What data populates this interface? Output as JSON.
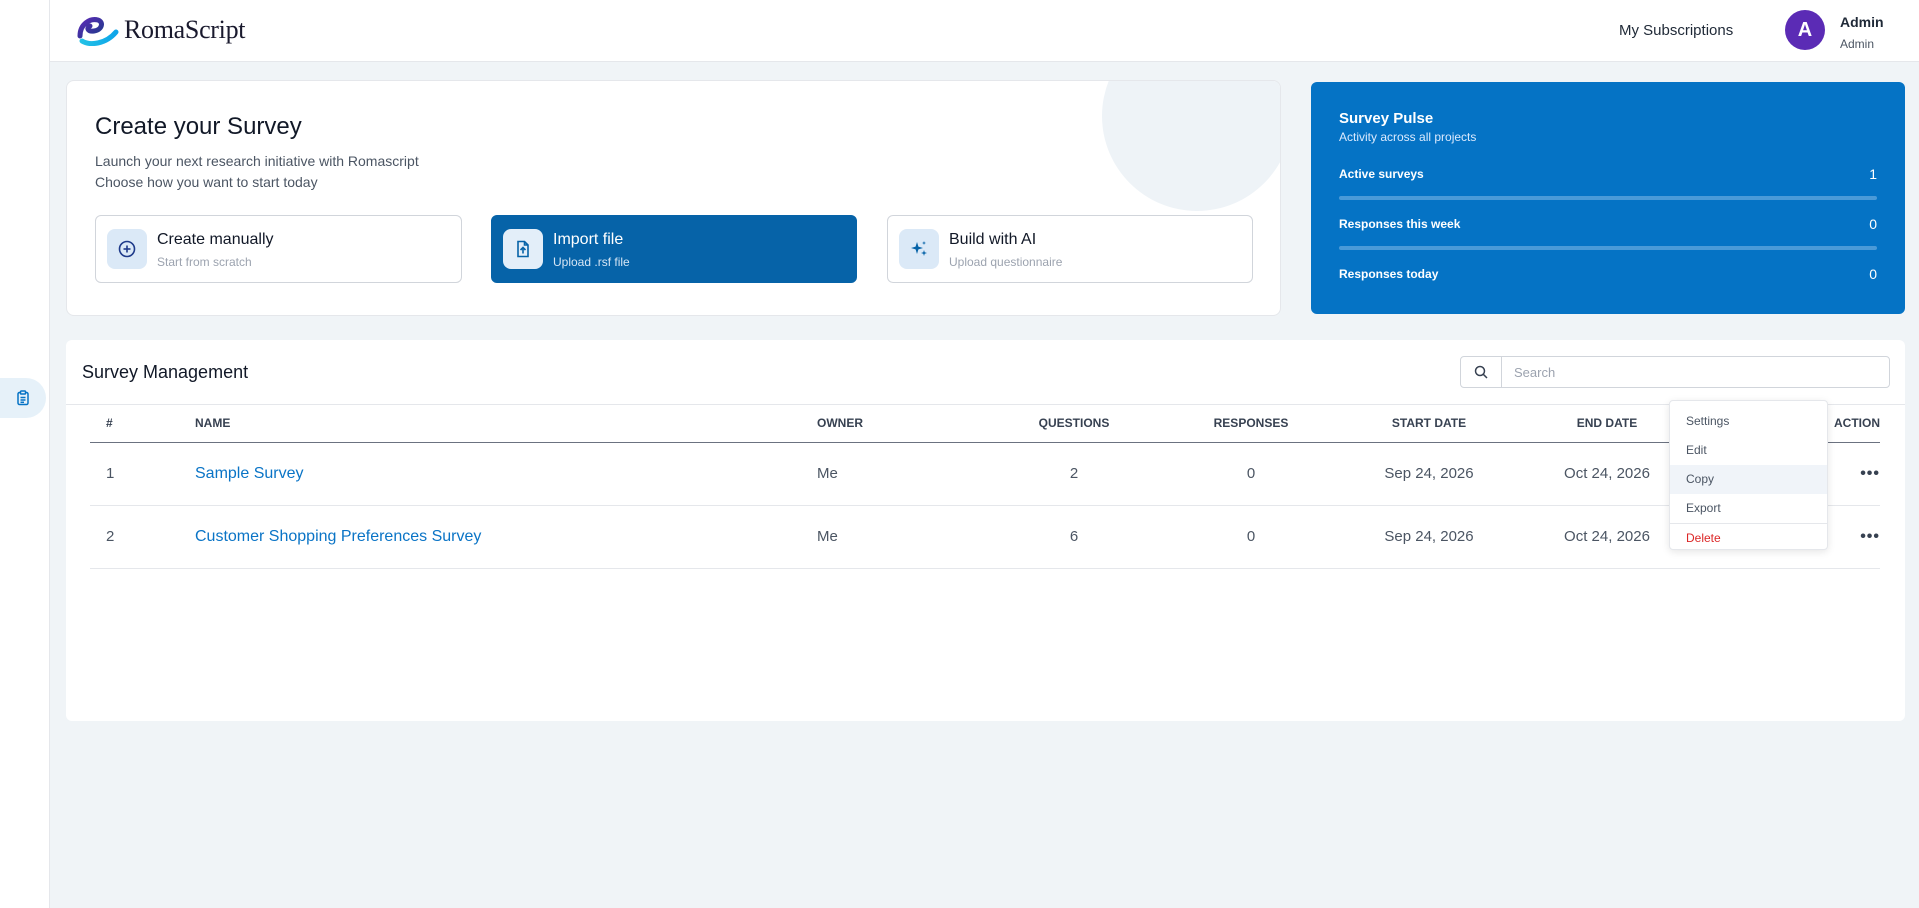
{
  "brand": {
    "name": "RomaScript"
  },
  "header": {
    "subscriptions_label": "My Subscriptions",
    "user": {
      "initial": "A",
      "name": "Admin",
      "role": "Admin",
      "avatar_color": "#5b2bb5"
    }
  },
  "sidebar": {
    "items": [
      {
        "icon": "clipboard-icon",
        "active": true
      }
    ]
  },
  "create": {
    "title": "Create your Survey",
    "subtitle_line1": "Launch your next research initiative with Romascript",
    "subtitle_line2": "Choose how you want to start today",
    "options": [
      {
        "label": "Create manually",
        "sub": "Start from scratch",
        "icon": "plus-circle-icon"
      },
      {
        "label": "Import file",
        "sub": "Upload .rsf file",
        "icon": "file-upload-icon",
        "selected": true
      },
      {
        "label": "Build with AI",
        "sub": "Upload questionnaire",
        "icon": "sparkles-icon"
      }
    ]
  },
  "pulse": {
    "title": "Survey Pulse",
    "subtitle": "Activity across all projects",
    "rows": [
      {
        "label": "Active surveys",
        "value": "1"
      },
      {
        "label": "Responses this week",
        "value": "0"
      },
      {
        "label": "Responses today",
        "value": "0"
      }
    ]
  },
  "management": {
    "title": "Survey Management",
    "search_placeholder": "Search",
    "columns": [
      "#",
      "NAME",
      "OWNER",
      "QUESTIONS",
      "RESPONSES",
      "START DATE",
      "END DATE",
      "ACTION"
    ],
    "rows": [
      {
        "num": "1",
        "name": "Sample Survey",
        "owner": "Me",
        "questions": "2",
        "responses": "0",
        "start": "Sep 24, 2026",
        "end": "Oct 24, 2026"
      },
      {
        "num": "2",
        "name": "Customer Shopping Preferences Survey",
        "owner": "Me",
        "questions": "6",
        "responses": "0",
        "start": "Sep 24, 2026",
        "end": "Oct 24, 2026"
      }
    ],
    "action_menu": {
      "items": [
        "Settings",
        "Edit",
        "Copy",
        "Export"
      ],
      "danger_item": "Delete",
      "hovered": "Copy"
    }
  },
  "colors": {
    "primary": "#0573c5",
    "primary_dark": "#0663a8",
    "link": "#0a74c6",
    "danger": "#dc2626",
    "page_bg": "#f0f4f7"
  }
}
